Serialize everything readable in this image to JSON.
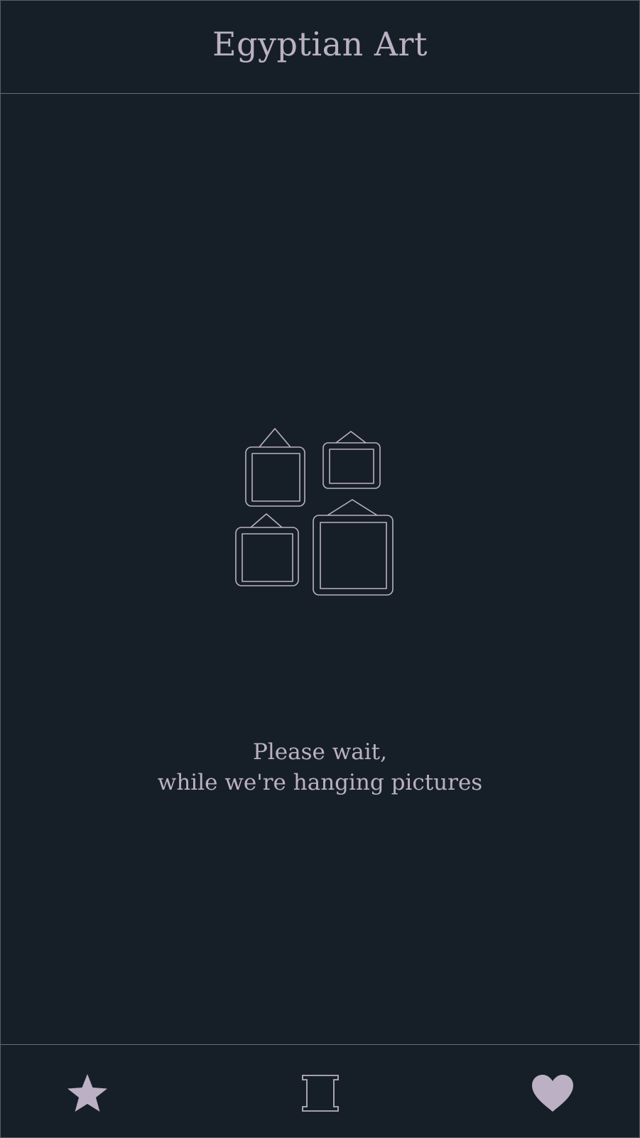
{
  "header": {
    "title": "Egyptian Art"
  },
  "loading": {
    "line1": "Please wait,",
    "line2": "while we're hanging pictures",
    "icon": "hanging-pictures-icon"
  },
  "bottom_nav": {
    "items": [
      {
        "icon": "star-icon"
      },
      {
        "icon": "frame-icon"
      },
      {
        "icon": "heart-icon"
      }
    ]
  },
  "colors": {
    "background": "#161f27",
    "accent": "#bbb0c4",
    "divider": "#6b6e76"
  }
}
